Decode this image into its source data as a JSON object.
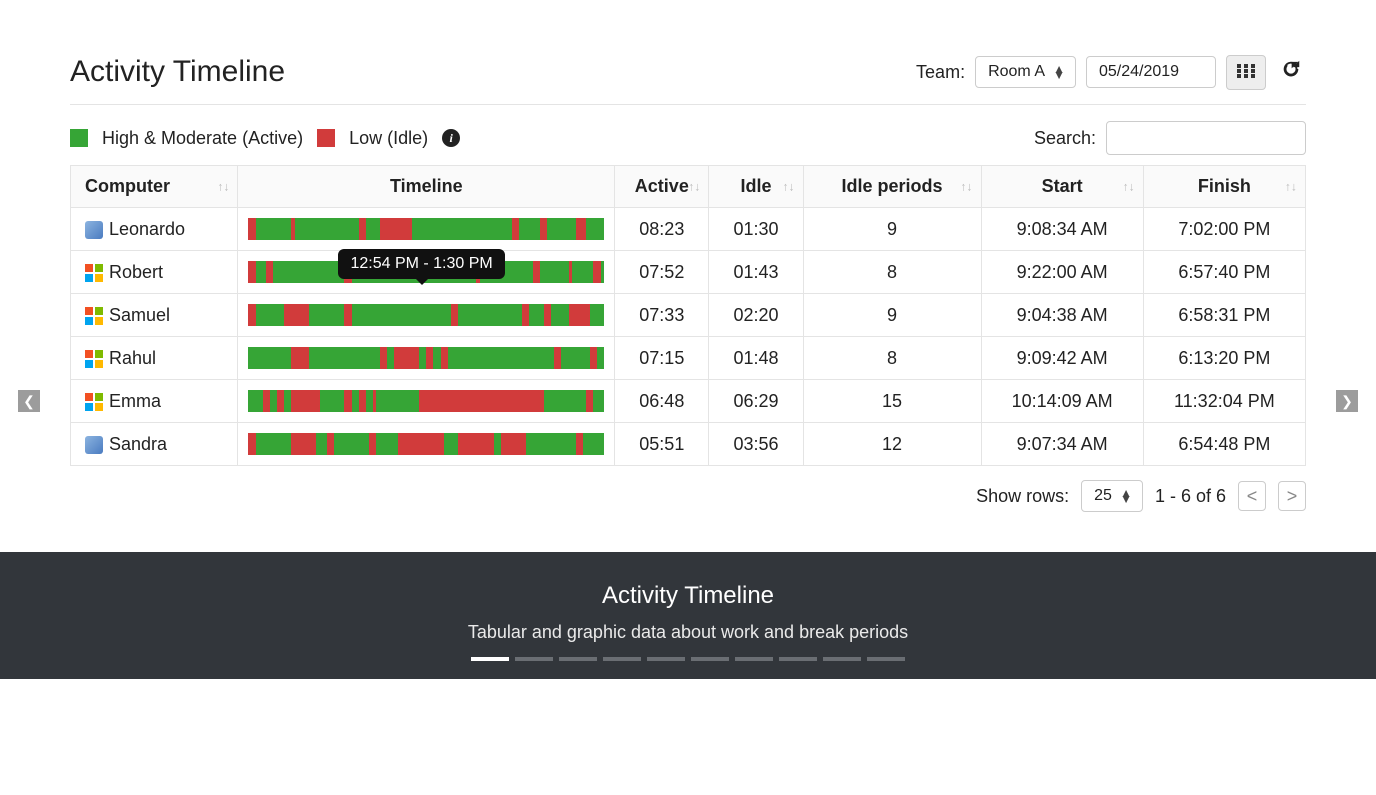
{
  "header": {
    "title": "Activity Timeline",
    "team_label": "Team:",
    "team_value": "Room A",
    "date_value": "05/24/2019"
  },
  "legend": {
    "active_label": "High & Moderate (Active)",
    "idle_label": "Low (Idle)"
  },
  "search": {
    "label": "Search:"
  },
  "columns": {
    "computer": "Computer",
    "timeline": "Timeline",
    "active": "Active",
    "idle": "Idle",
    "idle_periods": "Idle periods",
    "start": "Start",
    "finish": "Finish"
  },
  "tooltip": "12:54 PM - 1:30 PM",
  "rows": [
    {
      "os": "mac",
      "name": "Leonardo",
      "active": "08:23",
      "idle": "01:30",
      "idle_periods": "9",
      "start": "9:08:34 AM",
      "finish": "7:02:00 PM",
      "segments": [
        [
          "i",
          2
        ],
        [
          "a",
          10
        ],
        [
          "i",
          1
        ],
        [
          "a",
          18
        ],
        [
          "i",
          2
        ],
        [
          "a",
          4
        ],
        [
          "i",
          9
        ],
        [
          "a",
          28
        ],
        [
          "i",
          2
        ],
        [
          "a",
          6
        ],
        [
          "i",
          2
        ],
        [
          "a",
          8
        ],
        [
          "i",
          3
        ],
        [
          "a",
          5
        ]
      ]
    },
    {
      "os": "win",
      "name": "Robert",
      "active": "07:52",
      "idle": "01:43",
      "idle_periods": "8",
      "start": "9:22:00 AM",
      "finish": "6:57:40 PM",
      "segments": [
        [
          "i",
          2
        ],
        [
          "a",
          3
        ],
        [
          "i",
          2
        ],
        [
          "a",
          20
        ],
        [
          "i",
          2
        ],
        [
          "a",
          35
        ],
        [
          "i",
          1
        ],
        [
          "a",
          15
        ],
        [
          "i",
          2
        ],
        [
          "a",
          8
        ],
        [
          "i",
          1
        ],
        [
          "a",
          6
        ],
        [
          "i",
          2
        ],
        [
          "a",
          1
        ]
      ]
    },
    {
      "os": "win",
      "name": "Samuel",
      "active": "07:33",
      "idle": "02:20",
      "idle_periods": "9",
      "start": "9:04:38 AM",
      "finish": "6:58:31 PM",
      "segments": [
        [
          "i",
          2
        ],
        [
          "a",
          8
        ],
        [
          "i",
          7
        ],
        [
          "a",
          10
        ],
        [
          "i",
          2
        ],
        [
          "a",
          28
        ],
        [
          "i",
          2
        ],
        [
          "a",
          18
        ],
        [
          "i",
          2
        ],
        [
          "a",
          4
        ],
        [
          "i",
          2
        ],
        [
          "a",
          5
        ],
        [
          "i",
          6
        ],
        [
          "a",
          4
        ]
      ]
    },
    {
      "os": "win",
      "name": "Rahul",
      "active": "07:15",
      "idle": "01:48",
      "idle_periods": "8",
      "start": "9:09:42 AM",
      "finish": "6:13:20 PM",
      "segments": [
        [
          "a",
          12
        ],
        [
          "i",
          5
        ],
        [
          "a",
          20
        ],
        [
          "i",
          2
        ],
        [
          "a",
          2
        ],
        [
          "i",
          7
        ],
        [
          "a",
          2
        ],
        [
          "i",
          2
        ],
        [
          "a",
          2
        ],
        [
          "i",
          2
        ],
        [
          "a",
          30
        ],
        [
          "i",
          2
        ],
        [
          "a",
          8
        ],
        [
          "i",
          2
        ],
        [
          "a",
          2
        ]
      ]
    },
    {
      "os": "win",
      "name": "Emma",
      "active": "06:48",
      "idle": "06:29",
      "idle_periods": "15",
      "start": "10:14:09 AM",
      "finish": "11:32:04 PM",
      "segments": [
        [
          "a",
          4
        ],
        [
          "i",
          2
        ],
        [
          "a",
          2
        ],
        [
          "i",
          2
        ],
        [
          "a",
          2
        ],
        [
          "i",
          8
        ],
        [
          "a",
          7
        ],
        [
          "i",
          2
        ],
        [
          "a",
          2
        ],
        [
          "i",
          2
        ],
        [
          "a",
          2
        ],
        [
          "i",
          1
        ],
        [
          "a",
          12
        ],
        [
          "i",
          35
        ],
        [
          "a",
          12
        ],
        [
          "i",
          2
        ],
        [
          "a",
          3
        ]
      ]
    },
    {
      "os": "mac",
      "name": "Sandra",
      "active": "05:51",
      "idle": "03:56",
      "idle_periods": "12",
      "start": "9:07:34 AM",
      "finish": "6:54:48 PM",
      "segments": [
        [
          "i",
          2
        ],
        [
          "a",
          10
        ],
        [
          "i",
          7
        ],
        [
          "a",
          3
        ],
        [
          "i",
          2
        ],
        [
          "a",
          10
        ],
        [
          "i",
          2
        ],
        [
          "a",
          6
        ],
        [
          "i",
          13
        ],
        [
          "a",
          4
        ],
        [
          "i",
          10
        ],
        [
          "a",
          2
        ],
        [
          "i",
          7
        ],
        [
          "a",
          14
        ],
        [
          "i",
          2
        ],
        [
          "a",
          6
        ]
      ]
    }
  ],
  "pager": {
    "show_rows_label": "Show rows:",
    "show_rows_value": "25",
    "range": "1 - 6 of 6"
  },
  "caption": {
    "title": "Activity Timeline",
    "sub": "Tabular and graphic data about work and break periods"
  },
  "chart_data": {
    "type": "table",
    "title": "Activity Timeline",
    "legend": {
      "active_color": "#36a536",
      "idle_color": "#d13b3b"
    },
    "columns": [
      "Computer",
      "Active",
      "Idle",
      "Idle periods",
      "Start",
      "Finish"
    ],
    "rows": [
      [
        "Leonardo",
        "08:23",
        "01:30",
        9,
        "9:08:34 AM",
        "7:02:00 PM"
      ],
      [
        "Robert",
        "07:52",
        "01:43",
        8,
        "9:22:00 AM",
        "6:57:40 PM"
      ],
      [
        "Samuel",
        "07:33",
        "02:20",
        9,
        "9:04:38 AM",
        "6:58:31 PM"
      ],
      [
        "Rahul",
        "07:15",
        "01:48",
        8,
        "9:09:42 AM",
        "6:13:20 PM"
      ],
      [
        "Emma",
        "06:48",
        "06:29",
        15,
        "10:14:09 AM",
        "11:32:04 PM"
      ],
      [
        "Sandra",
        "05:51",
        "03:56",
        12,
        "9:07:34 AM",
        "6:54:48 PM"
      ]
    ]
  }
}
